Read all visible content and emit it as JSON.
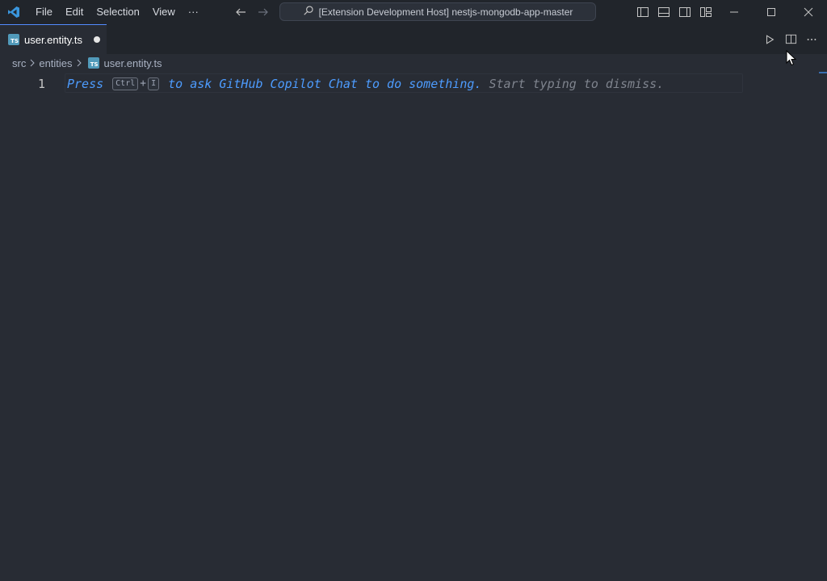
{
  "menu": [
    "File",
    "Edit",
    "Selection",
    "View",
    "···"
  ],
  "command_center": {
    "text": "[Extension Development Host] nestjs-mongodb-app-master"
  },
  "tab": {
    "label": "user.entity.ts",
    "icon_text": "TS"
  },
  "breadcrumb": {
    "folder1": "src",
    "folder2": "entities",
    "file": "user.entity.ts"
  },
  "editor": {
    "line_number": "1",
    "hint_press": "Press",
    "hint_key1": "Ctrl",
    "hint_plus": "+",
    "hint_key2": "I",
    "hint_action": "to ask GitHub Copilot Chat to do something.",
    "hint_dismiss": "Start typing to dismiss."
  },
  "colors": {
    "accent": "#528bff",
    "hint": "#4d9cff",
    "background": "#282c34",
    "titlebar": "#21252b"
  },
  "icons": [
    "vscode-logo-icon",
    "back-arrow-icon",
    "forward-arrow-icon",
    "search-icon",
    "toggle-primary-sidebar-icon",
    "toggle-panel-icon",
    "toggle-secondary-sidebar-icon",
    "customize-layout-icon",
    "minimize-icon",
    "maximize-icon",
    "close-icon",
    "run-icon",
    "split-editor-icon",
    "more-actions-icon",
    "typescript-file-icon",
    "chevron-right-icon",
    "mouse-cursor-icon"
  ]
}
